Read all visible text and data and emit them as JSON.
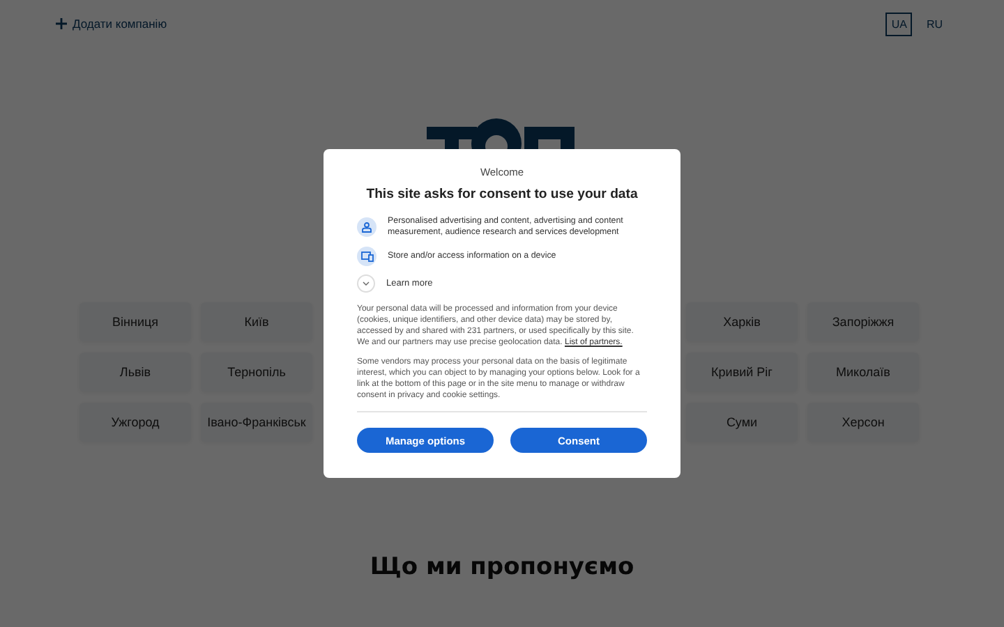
{
  "header": {
    "add_company": "Додати компанію",
    "languages": [
      {
        "label": "UA",
        "selected": true
      },
      {
        "label": "RU",
        "selected": false
      }
    ]
  },
  "cities": [
    {
      "left": [
        "Вінниця",
        "Київ"
      ],
      "right": [
        "Харків",
        "Запоріжжя"
      ]
    },
    {
      "left": [
        "Львів",
        "Тернопіль"
      ],
      "right": [
        "Кривий Ріг",
        "Миколаїв"
      ]
    },
    {
      "left": [
        "Ужгород",
        "Івано-Франківськ"
      ],
      "right": [
        "Суми",
        "Херсон"
      ]
    }
  ],
  "section_title": "Що ми пропонуємо",
  "consent_dialog": {
    "subtitle": "Welcome",
    "title": "This site asks for consent to use your data",
    "purposes": [
      {
        "kind": "person",
        "text": "Personalised advertising and content, advertising and content measurement, audience research and services development"
      },
      {
        "kind": "device",
        "text": "Store and/or access information on a device"
      }
    ],
    "learn_more": {
      "label": "Learn more",
      "expanded": false
    },
    "paragraph_1": "Your personal data will be processed and information from your device (cookies, unique identifiers, and other device data) may be stored by, accessed by and shared with 231 partners, or used specifically by this site. We and our partners may use precise geolocation data.",
    "partners_link": "List of partners.",
    "paragraph_2": "Some vendors may process your personal data on the basis of legitimate interest, which you can object to by managing your options below. Look for a link at the bottom of this page or in the site menu to manage or withdraw consent in privacy and cookie settings.",
    "buttons": [
      "Manage options",
      "Consent"
    ]
  }
}
